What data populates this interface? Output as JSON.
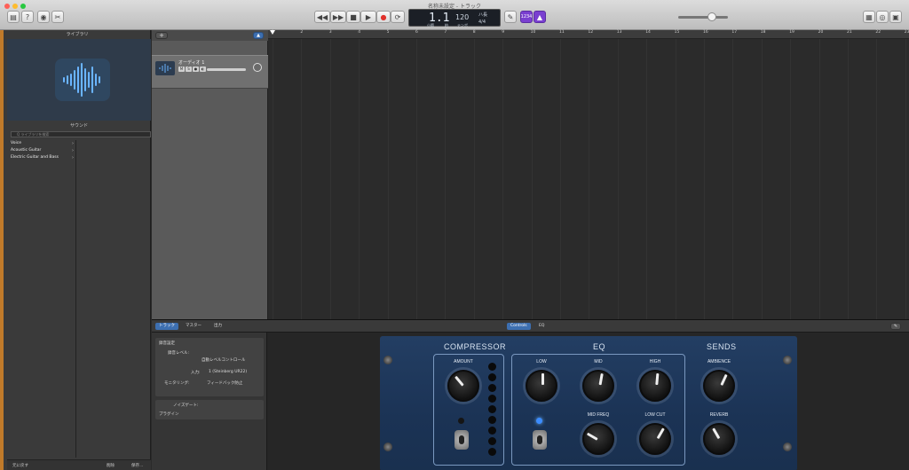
{
  "window": {
    "title": "名称未設定 - トラック"
  },
  "toolbar": {
    "left_icons": [
      "library-icon",
      "help-icon",
      "smart-controls-icon",
      "editors-icon"
    ],
    "transport": [
      "rewind-icon",
      "fast-forward-icon",
      "stop-icon",
      "play-icon",
      "record-icon",
      "cycle-icon"
    ],
    "lcd": {
      "position": "1.1",
      "bar_label": "小節",
      "beat_label": "拍",
      "tempo": "120",
      "tempo_label": "テンポ",
      "key_top": "ハ長",
      "key_bottom": "4/4"
    },
    "tuner_icon": "tuner-icon",
    "count_in": "1234",
    "metronome_icon": "metronome-icon",
    "right_icons": [
      "notepad-icon",
      "loop-browser-icon",
      "media-browser-icon"
    ]
  },
  "library": {
    "title": "ライブラリ",
    "section": "サウンド",
    "search_placeholder": "Q ライブラリを検索",
    "items": [
      {
        "label": "Voice"
      },
      {
        "label": "Acoustic Guitar"
      },
      {
        "label": "Electric Guitar and Bass"
      }
    ],
    "footer": {
      "left": "元に戻す",
      "middle": "削除",
      "right": "保存..."
    }
  },
  "tracks": {
    "add_label": "+",
    "track": {
      "name": "オーディオ 1"
    }
  },
  "ruler": {
    "marks": [
      "1",
      "2",
      "3",
      "4",
      "5",
      "6",
      "7",
      "8",
      "9",
      "10",
      "11",
      "12",
      "13",
      "14",
      "15",
      "16",
      "17",
      "18",
      "19",
      "20",
      "21",
      "22",
      "23"
    ]
  },
  "bottom": {
    "tabs": [
      "トラック",
      "マスター",
      "出力"
    ],
    "center_tabs": [
      "Controls",
      "EQ"
    ],
    "inspector": {
      "group_title": "録音設定",
      "level_label": "録音レベル:",
      "auto_label": "自動レベルコントロール",
      "input_label": "入力:",
      "input_value": "1 (Steinberg UR22)",
      "monitor_label": "モニタリング:",
      "monitor_value": "フィードバック防止",
      "noise_label": "ノイズゲート:",
      "plugins_label": "プラグイン"
    }
  },
  "plugin": {
    "compressor": {
      "title": "COMPRESSOR",
      "amount_label": "AMOUNT"
    },
    "eq": {
      "title": "EQ",
      "low": "LOW",
      "mid": "MID",
      "high": "HIGH",
      "mid_freq": "MID FREQ",
      "low_cut": "LOW CUT"
    },
    "sends": {
      "title": "SENDS",
      "ambience": "AMBIENCE",
      "reverb": "REVERB"
    }
  }
}
